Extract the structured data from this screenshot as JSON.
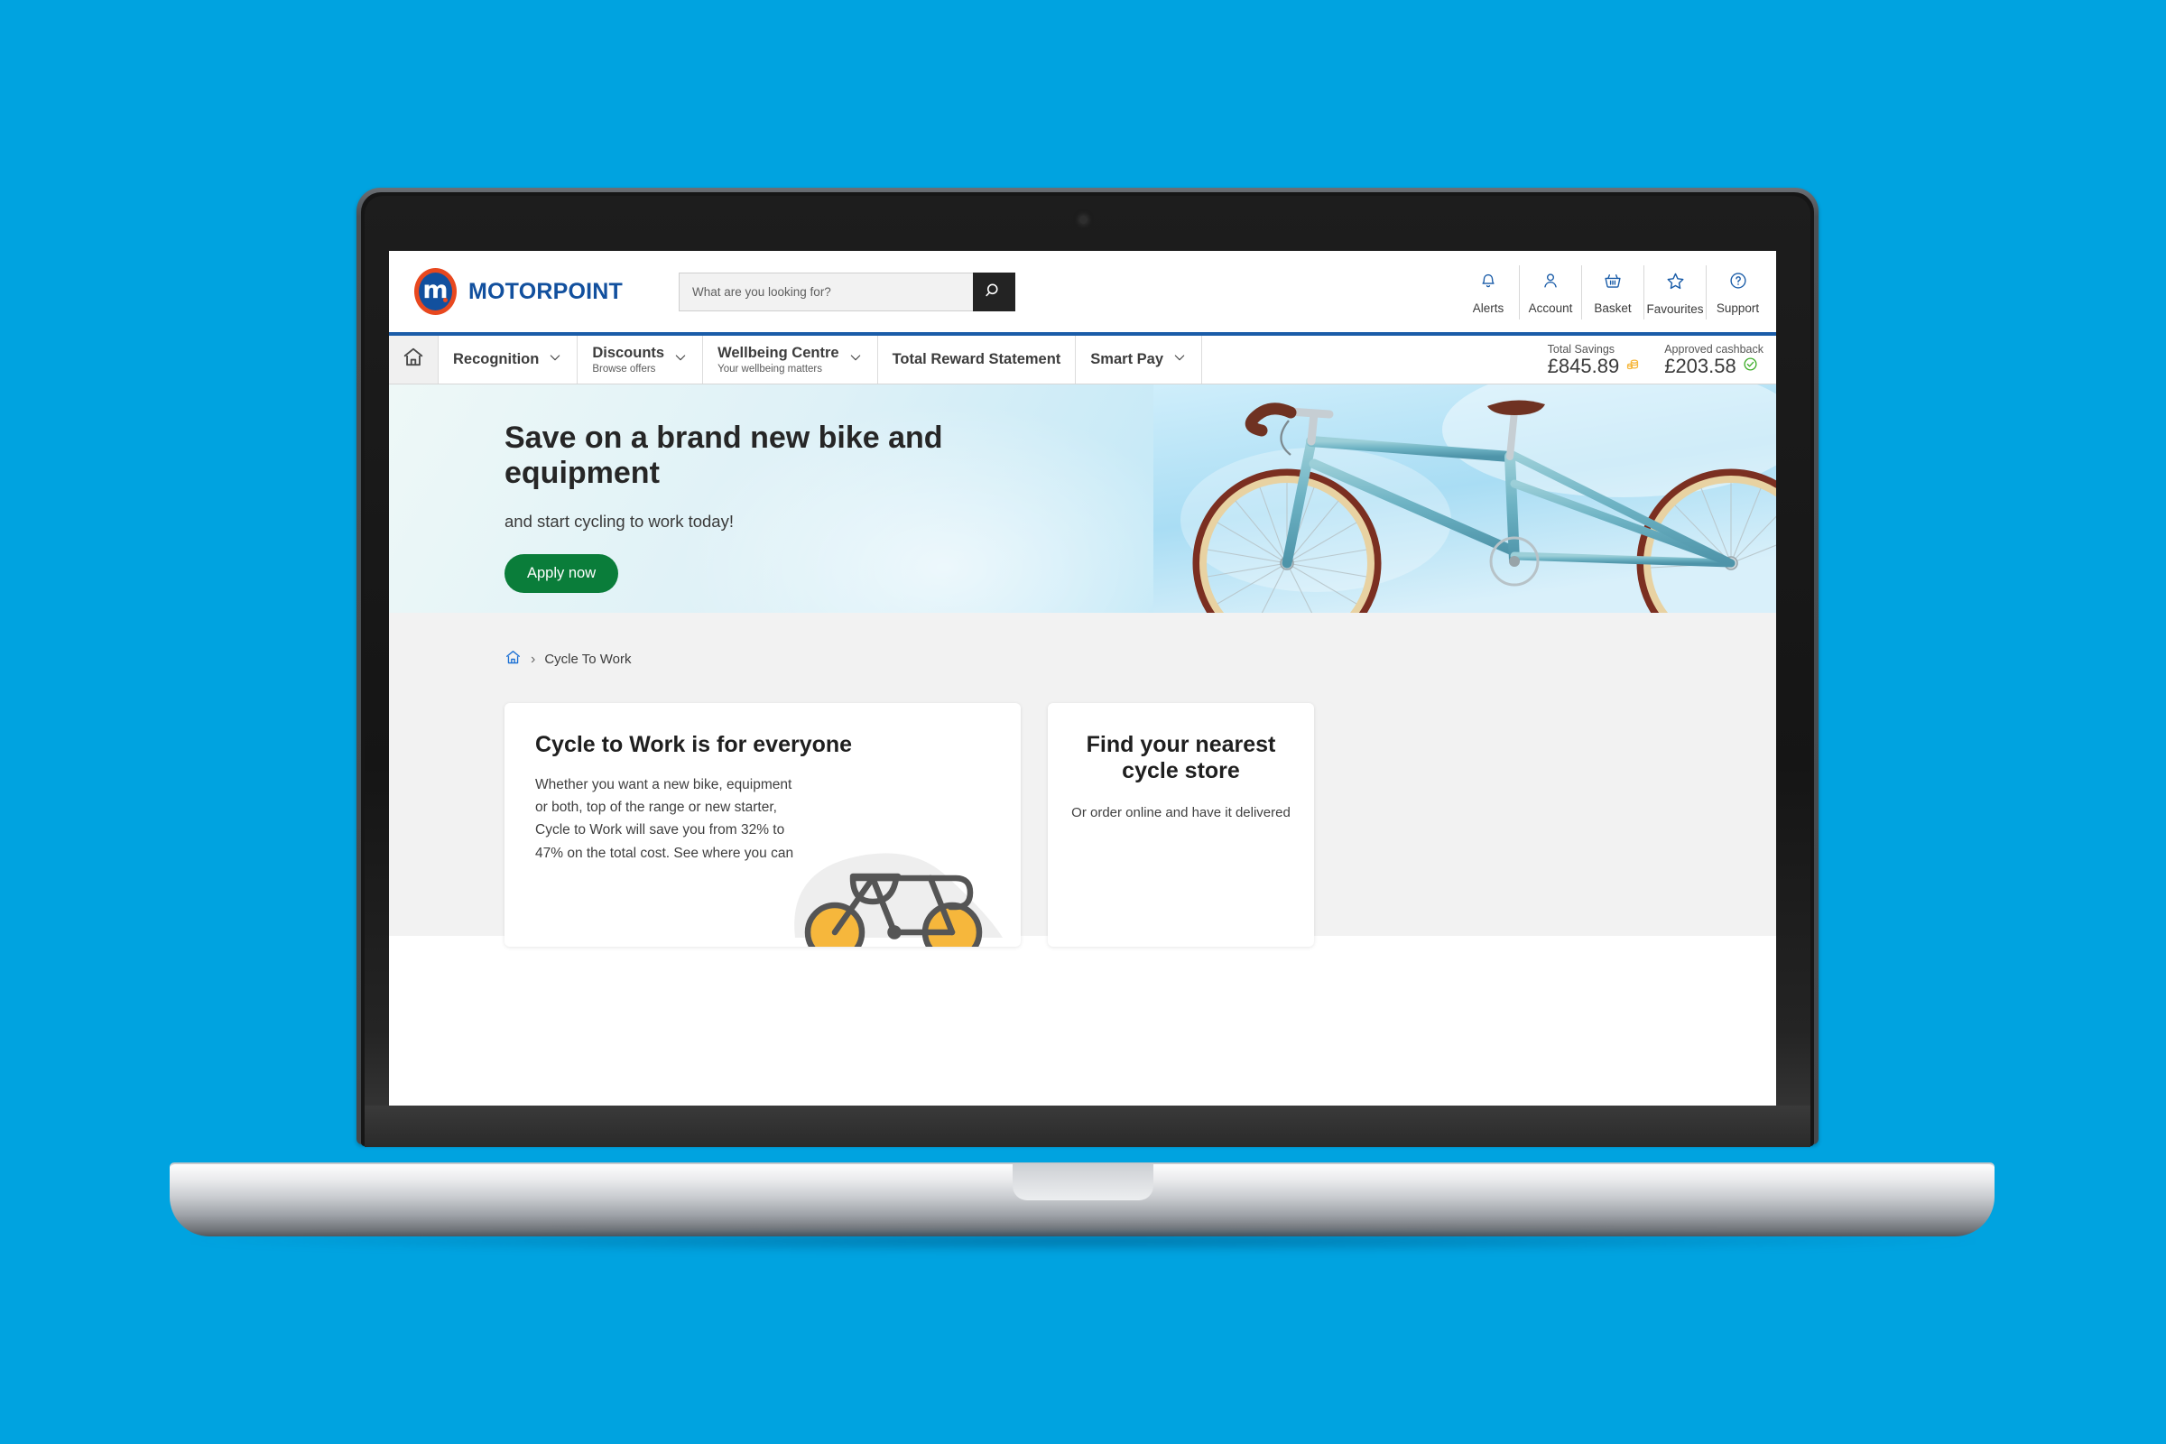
{
  "background_color": "#00A3E0",
  "header": {
    "brand": {
      "logo_letter": "m",
      "name": "MOTORPOINT",
      "logo_ring_color": "#E8481F",
      "logo_fill_color": "#12509E"
    },
    "search": {
      "placeholder": "What are you looking for?",
      "value": "",
      "button_icon": "search-icon"
    },
    "actions": [
      {
        "icon": "bell-icon",
        "label": "Alerts"
      },
      {
        "icon": "user-icon",
        "label": "Account"
      },
      {
        "icon": "basket-icon",
        "label": "Basket"
      },
      {
        "icon": "star-icon",
        "label": "Favourites"
      },
      {
        "icon": "question-circle-icon",
        "label": "Support"
      }
    ]
  },
  "nav": {
    "accent_color": "#1a5CA8",
    "home_icon": "home-icon",
    "items": [
      {
        "title": "Recognition",
        "subtitle": "",
        "has_dropdown": true
      },
      {
        "title": "Discounts",
        "subtitle": "Browse offers",
        "has_dropdown": true
      },
      {
        "title": "Wellbeing Centre",
        "subtitle": "Your wellbeing matters",
        "has_dropdown": true
      },
      {
        "title": "Total Reward Statement",
        "subtitle": "",
        "has_dropdown": false
      },
      {
        "title": "Smart Pay",
        "subtitle": "",
        "has_dropdown": true
      }
    ],
    "stats": [
      {
        "label": "Total Savings",
        "value": "£845.89",
        "icon": "coins-icon",
        "icon_color": "#F6B73C"
      },
      {
        "label": "Approved cashback",
        "value": "£203.58",
        "icon": "check-circle-icon",
        "icon_color": "#3FAE2A"
      }
    ]
  },
  "hero": {
    "heading": "Save on a brand new bike and equipment",
    "subheading": "and start cycling to work today!",
    "cta_label": "Apply now",
    "cta_color": "#0A7D3A",
    "image_alt": "bicycle-photo"
  },
  "breadcrumb": {
    "home_icon": "home-icon",
    "separator": "›",
    "current": "Cycle To Work"
  },
  "cards": [
    {
      "title": "Cycle to Work is for everyone",
      "body": "Whether you want a new bike, equipment or both, top of the range or new starter, Cycle to Work will save you from 32% to 47% on the total cost. See where you can",
      "illustration": "bicycle-line-icon"
    },
    {
      "title": "Find your nearest cycle store",
      "body": "Or order online and have it delivered",
      "illustration": ""
    }
  ]
}
